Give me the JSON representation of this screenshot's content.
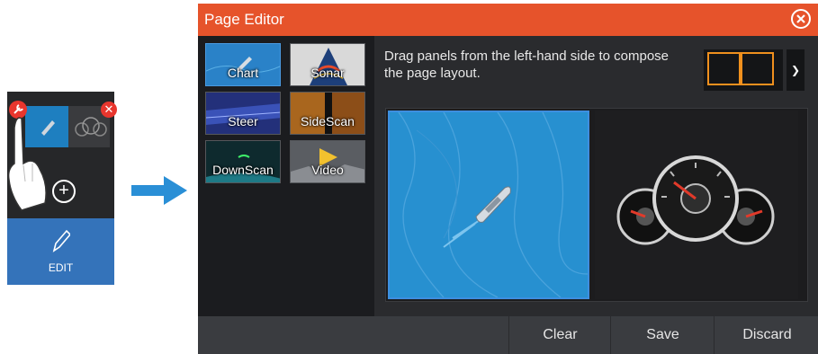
{
  "mini": {
    "edit_label": "EDIT"
  },
  "dialog": {
    "title": "Page Editor",
    "instructions": "Drag panels from the left-hand side to compose the page layout.",
    "panels": [
      {
        "label": "Chart"
      },
      {
        "label": "Sonar"
      },
      {
        "label": "Steer"
      },
      {
        "label": "SideScan"
      },
      {
        "label": "DownScan"
      },
      {
        "label": "Video"
      }
    ],
    "buttons": {
      "clear": "Clear",
      "save": "Save",
      "discard": "Discard"
    }
  },
  "colors": {
    "titlebar": "#e6532b",
    "accent_blue": "#3473ba",
    "layout_highlight": "#f0901e"
  }
}
